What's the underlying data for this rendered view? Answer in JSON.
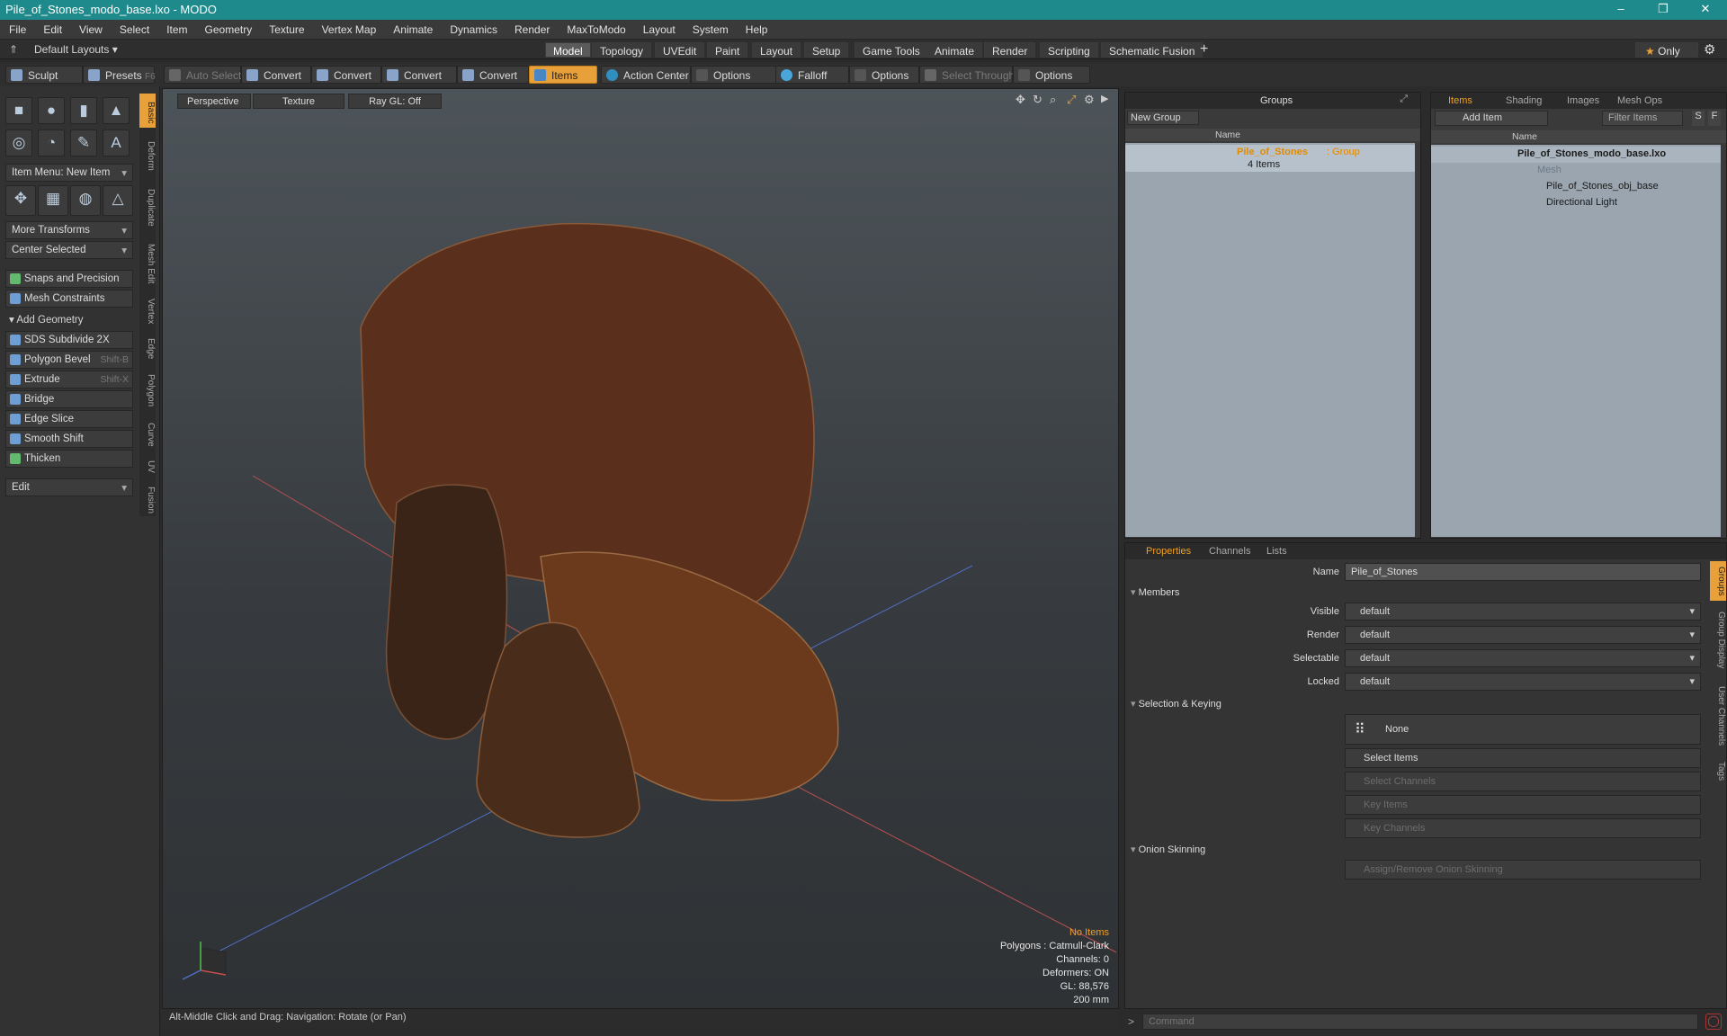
{
  "window": {
    "title": "Pile_of_Stones_modo_base.lxo - MODO",
    "controls": [
      "–",
      "❐",
      "✕"
    ]
  },
  "menu": [
    "File",
    "Edit",
    "View",
    "Select",
    "Item",
    "Geometry",
    "Texture",
    "Vertex Map",
    "Animate",
    "Dynamics",
    "Render",
    "MaxToModo",
    "Layout",
    "System",
    "Help"
  ],
  "layout_dropdown": "Default Layouts",
  "layout_tabs": [
    "Model",
    "Topology",
    "UVEdit",
    "Paint",
    "Layout",
    "Setup",
    "Game Tools",
    "Animate",
    "Render",
    "Scripting",
    "Schematic Fusion"
  ],
  "only_label": "Only",
  "toolbar": {
    "sculpt": "Sculpt",
    "presets": "Presets",
    "presets_key": "F6",
    "auto_select": "Auto Select",
    "convert": "Convert",
    "items": "Items",
    "action_center": "Action Center",
    "options": "Options",
    "falloff": "Falloff",
    "select_through": "Select Through"
  },
  "left": {
    "item_menu": "Item Menu: New Item",
    "more_transforms": "More Transforms",
    "center_selected": "Center Selected",
    "snaps": "Snaps and Precision",
    "mesh_constraints": "Mesh Constraints",
    "add_geometry": "Add Geometry",
    "tools": [
      {
        "label": "SDS Subdivide 2X",
        "key": ""
      },
      {
        "label": "Polygon Bevel",
        "key": "Shift-B"
      },
      {
        "label": "Extrude",
        "key": "Shift-X"
      },
      {
        "label": "Bridge",
        "key": ""
      },
      {
        "label": "Edge Slice",
        "key": ""
      },
      {
        "label": "Smooth Shift",
        "key": ""
      },
      {
        "label": "Thicken",
        "key": ""
      }
    ],
    "edit": "Edit",
    "vtabs": [
      "Basic",
      "Deform",
      "Duplicate",
      "Mesh Edit",
      "Vertex",
      "Edge",
      "Polygon",
      "Curve",
      "UV",
      "Fusion"
    ]
  },
  "viewport": {
    "tabs": [
      "Perspective",
      "Texture",
      "Ray GL: Off"
    ],
    "stats": {
      "items": "No Items",
      "polygons": "Polygons : Catmull-Clark",
      "channels": "Channels: 0",
      "deformers": "Deformers: ON",
      "gl": "GL: 88,576",
      "scale": "200 mm"
    }
  },
  "status": "Alt-Middle Click and Drag:   Navigation: Rotate (or Pan)",
  "groups": {
    "title": "Groups",
    "new_group": "New Group",
    "col_name": "Name",
    "group_name": "Pile_of_Stones",
    "group_type": ": Group",
    "group_count": "4 Items"
  },
  "items": {
    "tabs": [
      "Items",
      "Shading",
      "Images",
      "Mesh Ops"
    ],
    "add_item": "Add Item",
    "filter": "Filter Items",
    "col_name": "Name",
    "s": "S",
    "f": "F",
    "rows": [
      "Pile_of_Stones_modo_base.lxo",
      "Mesh",
      "Pile_of_Stones_obj_base",
      "Directional Light"
    ]
  },
  "properties": {
    "tabs": [
      "Properties",
      "Channels",
      "Lists"
    ],
    "name_label": "Name",
    "name_value": "Pile_of_Stones",
    "members": "Members",
    "visible": "Visible",
    "render": "Render",
    "selectable": "Selectable",
    "locked": "Locked",
    "default": "default",
    "sel_keying": "Selection & Keying",
    "none": "None",
    "select_items": "Select Items",
    "select_channels": "Select Channels",
    "key_items": "Key Items",
    "key_channels": "Key Channels",
    "onion": "Onion Skinning",
    "assign_onion": "Assign/Remove Onion Skinning",
    "vtabs": [
      "Groups",
      "Group Display",
      "User Channels",
      "Tags"
    ]
  },
  "command_placeholder": "Command",
  "colors": {
    "accent": "#e8a13a",
    "title": "#1f8a8c"
  }
}
